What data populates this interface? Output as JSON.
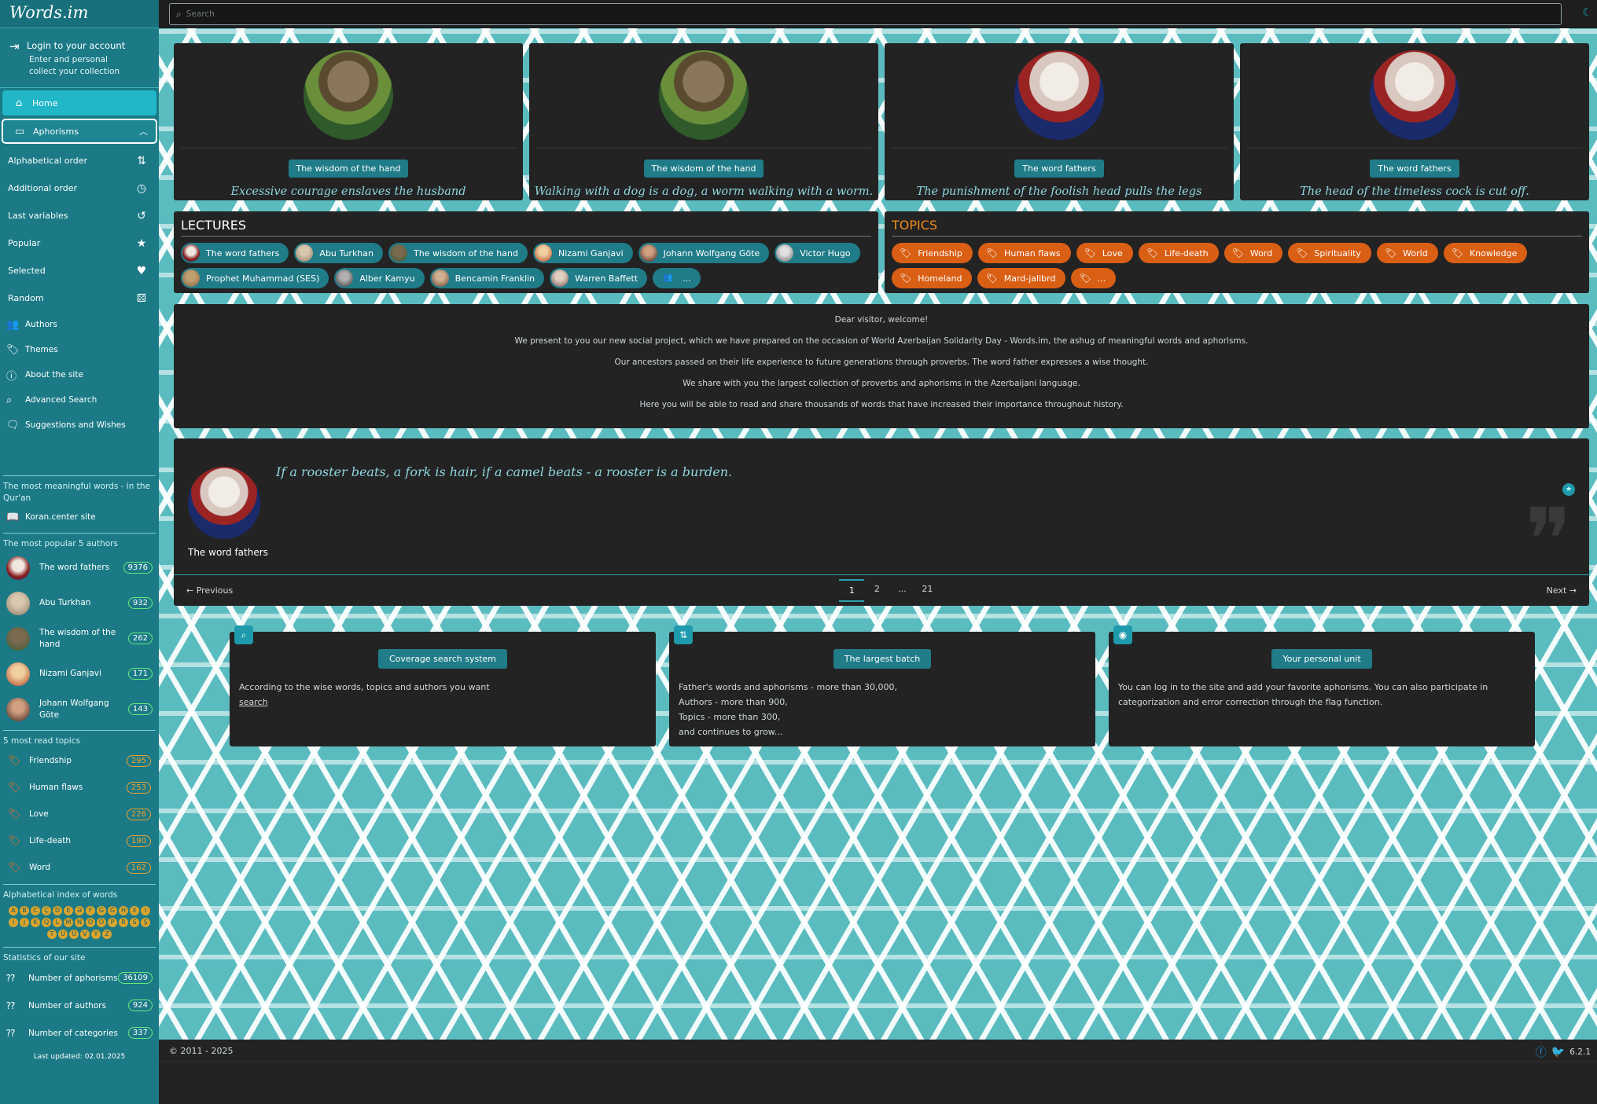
{
  "app": {
    "logo": "Words.im"
  },
  "search": {
    "placeholder": "Search"
  },
  "login": {
    "title": "Login to your account",
    "sub1": "Enter and personal",
    "sub2": "collect your collection"
  },
  "nav": {
    "home": "Home",
    "aphorisms": "Aphorisms"
  },
  "subnav": [
    "Alphabetical order",
    "Additional order",
    "Last variables",
    "Popular",
    "Selected",
    "Random"
  ],
  "menu": [
    "Authors",
    "Themes",
    "About the site",
    "Advanced Search",
    "Suggestions and Wishes"
  ],
  "quran": {
    "heading": "The most meaningful words - in the Qur'an",
    "link": "Koran.center site"
  },
  "popular_authors": {
    "heading": "The most popular 5 authors",
    "items": [
      {
        "name": "The word fathers",
        "count": "9376"
      },
      {
        "name": "Abu Turkhan",
        "count": "932"
      },
      {
        "name": "The wisdom of the hand",
        "count": "262"
      },
      {
        "name": "Nizami Ganjavi",
        "count": "171"
      },
      {
        "name": "Johann Wolfgang Göte",
        "count": "143"
      }
    ]
  },
  "read_topics": {
    "heading": "5 most read topics",
    "items": [
      {
        "name": "Friendship",
        "count": "295"
      },
      {
        "name": "Human flaws",
        "count": "253"
      },
      {
        "name": "Love",
        "count": "226"
      },
      {
        "name": "Life-death",
        "count": "190"
      },
      {
        "name": "Word",
        "count": "162"
      }
    ]
  },
  "alpha_index": {
    "heading": "Alphabetical index of words",
    "letters": [
      "A",
      "B",
      "C",
      "Ç",
      "D",
      "E",
      "Ə",
      "F",
      "G",
      "Ğ",
      "H",
      "X",
      "I",
      "İ",
      "J",
      "K",
      "Q",
      "L",
      "M",
      "N",
      "O",
      "Ö",
      "P",
      "R",
      "S",
      "Ş",
      "T",
      "U",
      "Ü",
      "V",
      "Y",
      "Z"
    ]
  },
  "stats": {
    "heading": "Statistics of our site",
    "items": [
      {
        "name": "Number of aphorisms",
        "count": "36109"
      },
      {
        "name": "Number of authors",
        "count": "924"
      },
      {
        "name": "Number of categories",
        "count": "337"
      }
    ]
  },
  "last_updated": "Last updated: 02.01.2025",
  "cards": [
    {
      "tag": "The wisdom of the hand",
      "quote": "Excessive courage enslaves the husband"
    },
    {
      "tag": "The wisdom of the hand",
      "quote": "Walking with a dog is a dog, a worm walking with a worm."
    },
    {
      "tag": "The word fathers",
      "quote": "The punishment of the foolish head pulls the legs"
    },
    {
      "tag": "The word fathers",
      "quote": "The head of the timeless cock is cut off."
    }
  ],
  "lectures": {
    "title": "LECTURES",
    "items": [
      "The word fathers",
      "Abu Turkhan",
      "The wisdom of the hand",
      "Nizami Ganjavi",
      "Johann Wolfgang Göte",
      "Victor Hugo",
      "Prophet Muhammad (SES)",
      "Alber Kamyu",
      "Bencamin Franklin",
      "Warren Baffett",
      "..."
    ]
  },
  "topics": {
    "title": "TOPICS",
    "items": [
      "Friendship",
      "Human flaws",
      "Love",
      "Life-death",
      "Word",
      "Spirituality",
      "World",
      "Knowledge",
      "Homeland",
      "Mard-jalibrd",
      "..."
    ]
  },
  "welcome": [
    "Dear visitor, welcome!",
    "We present to you our new social project, which we have prepared on the occasion of World Azerbaijan Solidarity Day - Words.im, the ashug of meaningful words and aphorisms.",
    "Our ancestors passed on their life experience to future generations through proverbs. The word father expresses a wise thought.",
    "We share with you the largest collection of proverbs and aphorisms in the Azerbaijani language.",
    "Here you will be able to read and share thousands of words that have increased their importance throughout history."
  ],
  "featured": {
    "quote": "If a rooster beats, a fork is hair, if a camel beats - a rooster is a burden.",
    "author": "The word fathers"
  },
  "pager": {
    "prev": "← Previous",
    "next": "Next →",
    "pages": [
      "1",
      "2",
      "...",
      "21"
    ]
  },
  "features": [
    {
      "button": "Coverage search system",
      "text": "According to the wise words, topics and authors you want",
      "link": "search"
    },
    {
      "button": "The largest batch",
      "lines": [
        "Father's words and aphorisms - more than 30,000,",
        "Authors - more than 900,",
        "Topics - more than 300,",
        "and continues to grow..."
      ]
    },
    {
      "button": "Your personal unit",
      "text": "You can log in to the site and add your favorite aphorisms. You can also participate in categorization and error correction through the flag function."
    }
  ],
  "footer": {
    "copyright": "© 2011 - 2025",
    "version": "6.2.1"
  },
  "colors": {
    "sidebar": "#1b7a86",
    "accent": "#1f7c88",
    "topic": "#d95f14",
    "pattern": "#5bbcc0"
  }
}
